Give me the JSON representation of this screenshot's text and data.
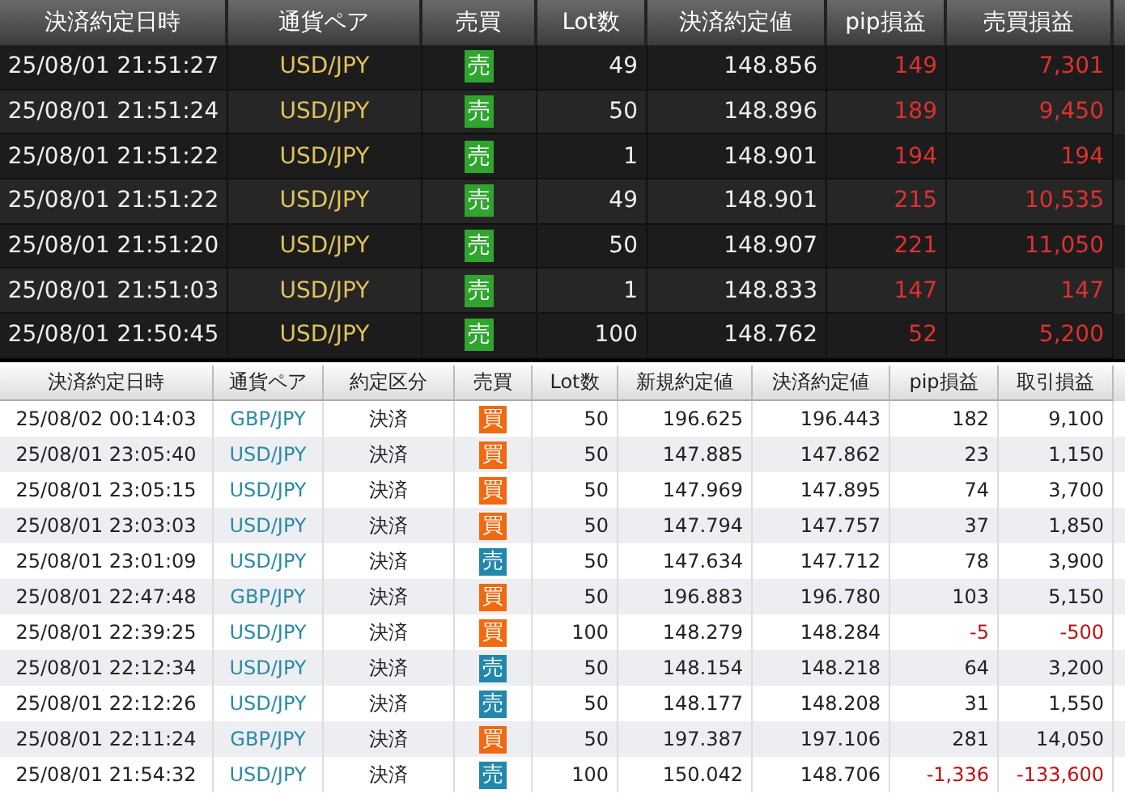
{
  "open_trades": {
    "columns": [
      "決済約定日時",
      "通貨ペア",
      "売買",
      "Lot数",
      "決済約定値",
      "pip損益",
      "売買損益"
    ],
    "rows": [
      {
        "time": "25/08/01 21:51:27",
        "pair": "USD/JPY",
        "side": {
          "label": "売",
          "kind": "sell"
        },
        "lot": "49",
        "price": "148.856",
        "pips": "149",
        "pnl": "7,301"
      },
      {
        "time": "25/08/01 21:51:24",
        "pair": "USD/JPY",
        "side": {
          "label": "売",
          "kind": "sell"
        },
        "lot": "50",
        "price": "148.896",
        "pips": "189",
        "pnl": "9,450"
      },
      {
        "time": "25/08/01 21:51:22",
        "pair": "USD/JPY",
        "side": {
          "label": "売",
          "kind": "sell"
        },
        "lot": "1",
        "price": "148.901",
        "pips": "194",
        "pnl": "194"
      },
      {
        "time": "25/08/01 21:51:22",
        "pair": "USD/JPY",
        "side": {
          "label": "売",
          "kind": "sell"
        },
        "lot": "49",
        "price": "148.901",
        "pips": "215",
        "pnl": "10,535"
      },
      {
        "time": "25/08/01 21:51:20",
        "pair": "USD/JPY",
        "side": {
          "label": "売",
          "kind": "sell"
        },
        "lot": "50",
        "price": "148.907",
        "pips": "221",
        "pnl": "11,050"
      },
      {
        "time": "25/08/01 21:51:03",
        "pair": "USD/JPY",
        "side": {
          "label": "売",
          "kind": "sell"
        },
        "lot": "1",
        "price": "148.833",
        "pips": "147",
        "pnl": "147"
      },
      {
        "time": "25/08/01 21:50:45",
        "pair": "USD/JPY",
        "side": {
          "label": "売",
          "kind": "sell"
        },
        "lot": "100",
        "price": "148.762",
        "pips": "52",
        "pnl": "5,200"
      }
    ]
  },
  "history": {
    "columns": [
      "決済約定日時",
      "通貨ペア",
      "約定区分",
      "売買",
      "Lot数",
      "新規約定値",
      "決済約定値",
      "pip損益",
      "取引損益"
    ],
    "rows": [
      {
        "time": "25/08/02 00:14:03",
        "pair": "GBP/JPY",
        "type": "決済",
        "side": {
          "label": "買",
          "kind": "buy"
        },
        "lot": "50",
        "open": "196.625",
        "close": "196.443",
        "pips": "182",
        "pnl": "9,100",
        "loss": false
      },
      {
        "time": "25/08/01 23:05:40",
        "pair": "USD/JPY",
        "type": "決済",
        "side": {
          "label": "買",
          "kind": "buy"
        },
        "lot": "50",
        "open": "147.885",
        "close": "147.862",
        "pips": "23",
        "pnl": "1,150",
        "loss": false
      },
      {
        "time": "25/08/01 23:05:15",
        "pair": "USD/JPY",
        "type": "決済",
        "side": {
          "label": "買",
          "kind": "buy"
        },
        "lot": "50",
        "open": "147.969",
        "close": "147.895",
        "pips": "74",
        "pnl": "3,700",
        "loss": false
      },
      {
        "time": "25/08/01 23:03:03",
        "pair": "USD/JPY",
        "type": "決済",
        "side": {
          "label": "買",
          "kind": "buy"
        },
        "lot": "50",
        "open": "147.794",
        "close": "147.757",
        "pips": "37",
        "pnl": "1,850",
        "loss": false
      },
      {
        "time": "25/08/01 23:01:09",
        "pair": "USD/JPY",
        "type": "決済",
        "side": {
          "label": "売",
          "kind": "sell"
        },
        "lot": "50",
        "open": "147.634",
        "close": "147.712",
        "pips": "78",
        "pnl": "3,900",
        "loss": false
      },
      {
        "time": "25/08/01 22:47:48",
        "pair": "GBP/JPY",
        "type": "決済",
        "side": {
          "label": "買",
          "kind": "buy"
        },
        "lot": "50",
        "open": "196.883",
        "close": "196.780",
        "pips": "103",
        "pnl": "5,150",
        "loss": false
      },
      {
        "time": "25/08/01 22:39:25",
        "pair": "USD/JPY",
        "type": "決済",
        "side": {
          "label": "買",
          "kind": "buy"
        },
        "lot": "100",
        "open": "148.279",
        "close": "148.284",
        "pips": "-5",
        "pnl": "-500",
        "loss": true
      },
      {
        "time": "25/08/01 22:12:34",
        "pair": "USD/JPY",
        "type": "決済",
        "side": {
          "label": "売",
          "kind": "sell"
        },
        "lot": "50",
        "open": "148.154",
        "close": "148.218",
        "pips": "64",
        "pnl": "3,200",
        "loss": false
      },
      {
        "time": "25/08/01 22:12:26",
        "pair": "USD/JPY",
        "type": "決済",
        "side": {
          "label": "売",
          "kind": "sell"
        },
        "lot": "50",
        "open": "148.177",
        "close": "148.208",
        "pips": "31",
        "pnl": "1,550",
        "loss": false
      },
      {
        "time": "25/08/01 22:11:24",
        "pair": "GBP/JPY",
        "type": "決済",
        "side": {
          "label": "買",
          "kind": "buy"
        },
        "lot": "50",
        "open": "197.387",
        "close": "197.106",
        "pips": "281",
        "pnl": "14,050",
        "loss": false
      },
      {
        "time": "25/08/01 21:54:32",
        "pair": "USD/JPY",
        "type": "決済",
        "side": {
          "label": "売",
          "kind": "sell"
        },
        "lot": "100",
        "open": "150.042",
        "close": "148.706",
        "pips": "-1,336",
        "pnl": "-133,600",
        "loss": true
      }
    ]
  }
}
